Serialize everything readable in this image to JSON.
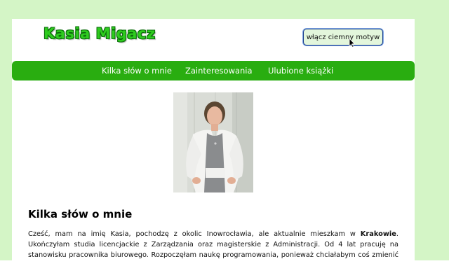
{
  "header": {
    "logo_text": "Kasia Migacz",
    "theme_button_label": "włącz ciemny motyw"
  },
  "nav": {
    "items": [
      {
        "label": "Kilka słów o mnie"
      },
      {
        "label": "Zainteresowania"
      },
      {
        "label": "Ulubione książki"
      }
    ]
  },
  "main": {
    "photo_icon": "profile-photo",
    "about": {
      "title": "Kilka słów o mnie",
      "text_before": "Cześć, mam na imię Kasia, pochodzę z okolic Inowrocławia, ale aktualnie mieszkam w ",
      "text_bold": "Krakowie",
      "text_after": ". Ukończyłam studia licencjackie z Zarządzania oraz magisterskie z Administracji. Od 4 lat pracuję na stanowisku pracownika biurowego. Rozpoczęłam naukę programowania, ponieważ chciałabym coś zmienić w swojej karierze zawodowej i dalej się rozwijać."
    }
  },
  "colors": {
    "page_background": "#d4f5c6",
    "navbar": "#29ad10",
    "logo": "#2ecc1e"
  }
}
